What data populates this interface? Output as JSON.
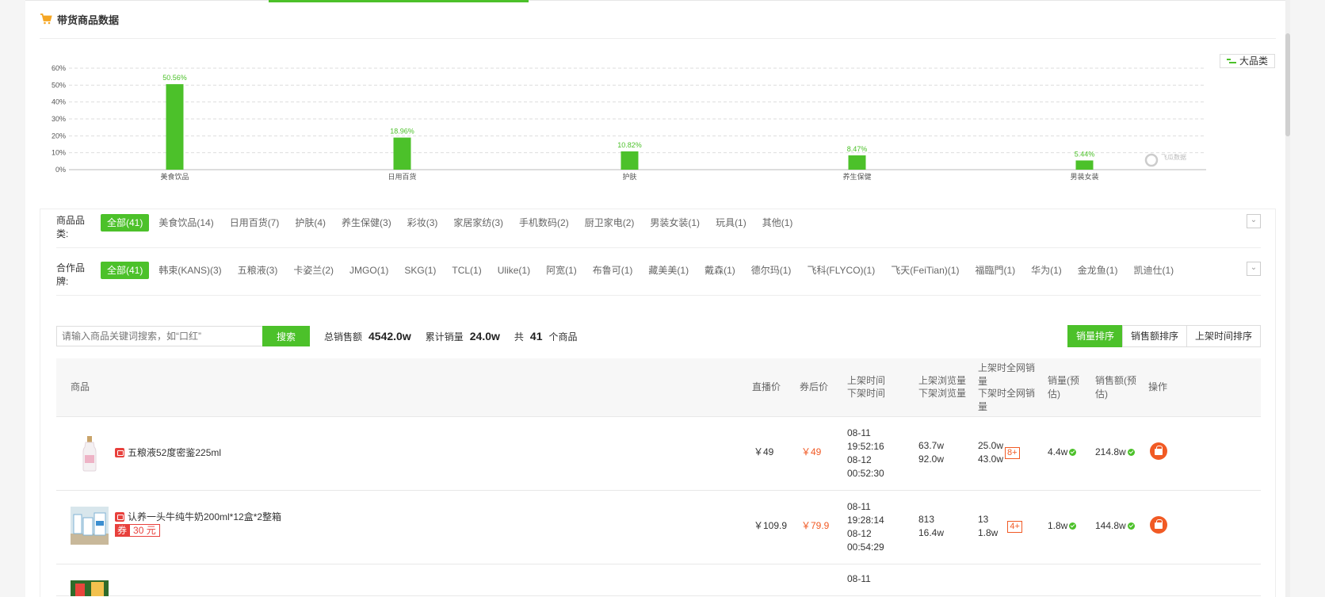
{
  "section": {
    "title": "带货商品数据",
    "legend_label": "大品类",
    "watermark": "飞瓜数据"
  },
  "chart_data": {
    "type": "bar",
    "categories": [
      "美食饮品",
      "日用百货",
      "护肤",
      "养生保健",
      "男装女装"
    ],
    "values": [
      50.56,
      18.96,
      10.82,
      8.47,
      5.44
    ],
    "data_labels": [
      "50.56%",
      "18.96%",
      "10.82%",
      "8.47%",
      "5.44%"
    ],
    "y_ticks": [
      "0%",
      "10%",
      "20%",
      "30%",
      "40%",
      "50%",
      "60%"
    ],
    "ylim": [
      0,
      60
    ],
    "grid": true,
    "legend": "top-right",
    "bar_color": "#4cc12a"
  },
  "filters": {
    "category_label": "商品品类:",
    "categories": [
      "全部(41)",
      "美食饮品(14)",
      "日用百货(7)",
      "护肤(4)",
      "养生保健(3)",
      "彩妆(3)",
      "家居家纺(3)",
      "手机数码(2)",
      "厨卫家电(2)",
      "男装女装(1)",
      "玩具(1)",
      "其他(1)"
    ],
    "brand_label": "合作品牌:",
    "brands": [
      "全部(41)",
      "韩束(KANS)(3)",
      "五粮液(3)",
      "卡姿兰(2)",
      "JMGO(1)",
      "SKG(1)",
      "TCL(1)",
      "Ulike(1)",
      "阿宽(1)",
      "布鲁可(1)",
      "藏美美(1)",
      "戴森(1)",
      "德尔玛(1)",
      "飞科(FLYCO)(1)",
      "飞天(FeiTian)(1)",
      "福臨門(1)",
      "华为(1)",
      "金龙鱼(1)",
      "凯迪仕(1)"
    ]
  },
  "search": {
    "placeholder": "请输入商品关键词搜索，如“口红”",
    "button": "搜索",
    "total_sales_label": "总销售额",
    "total_sales_value": "4542.0w",
    "total_volume_label": "累计销量",
    "total_volume_value": "24.0w",
    "count_prefix": "共",
    "count_value": "41",
    "count_suffix": "个商品"
  },
  "sort": [
    "销量排序",
    "销售额排序",
    "上架时间排序"
  ],
  "table": {
    "headers": {
      "product": "商品",
      "live_price": "直播价",
      "coupon_price": "券后价",
      "time_on": "上架时间",
      "time_off": "下架时间",
      "views_on": "上架浏览量",
      "views_off": "下架浏览量",
      "net_sales_on": "上架时全网销量",
      "net_sales_off": "下架时全网销量",
      "volume": "销量(预估)",
      "amount": "销售额(预估)",
      "op": "操作"
    },
    "rows": [
      {
        "name": "五粮液52度密鉴225ml",
        "live_price": "￥49",
        "coupon_price": "￥49",
        "on_date": "08-11",
        "on_time": "19:52:16",
        "off_date": "08-12",
        "off_time": "00:52:30",
        "views_on": "63.7w",
        "views_off": "92.0w",
        "net_on": "25.0w",
        "net_off": "43.0w",
        "badge": "8+",
        "volume": "4.4w",
        "amount": "214.8w"
      },
      {
        "name": "认养一头牛纯牛奶200ml*12盒*2整箱",
        "coupon_tag": "券",
        "coupon_value": "30 元",
        "live_price": "￥109.9",
        "coupon_price": "￥79.9",
        "on_date": "08-11",
        "on_time": "19:28:14",
        "off_date": "08-12",
        "off_time": "00:54:29",
        "views_on": "813",
        "views_off": "16.4w",
        "net_on": "13",
        "net_off": "1.8w",
        "badge": "4+",
        "volume": "1.8w",
        "amount": "144.8w"
      },
      {
        "on_date": "08-11"
      }
    ]
  }
}
